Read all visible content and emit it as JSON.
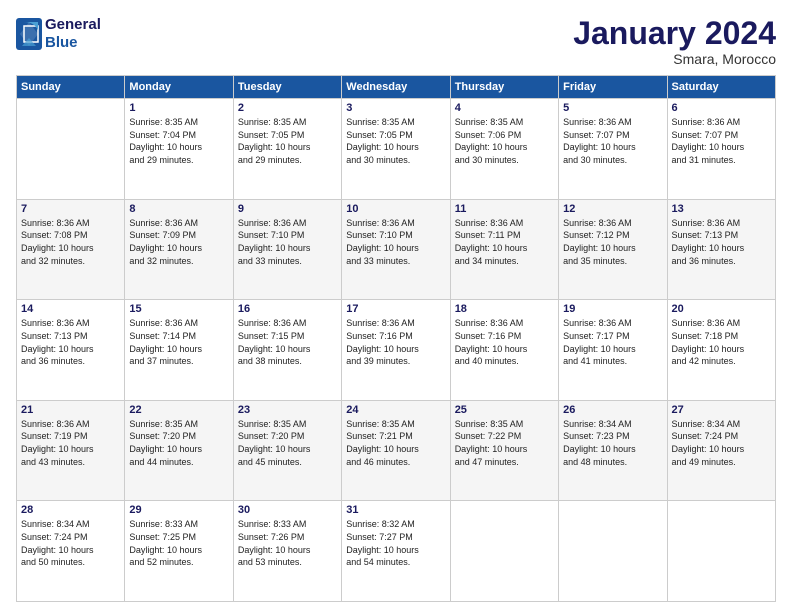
{
  "header": {
    "logo_line1": "General",
    "logo_line2": "Blue",
    "title": "January 2024",
    "subtitle": "Smara, Morocco"
  },
  "days_of_week": [
    "Sunday",
    "Monday",
    "Tuesday",
    "Wednesday",
    "Thursday",
    "Friday",
    "Saturday"
  ],
  "weeks": [
    [
      {
        "day": "",
        "info": ""
      },
      {
        "day": "1",
        "info": "Sunrise: 8:35 AM\nSunset: 7:04 PM\nDaylight: 10 hours\nand 29 minutes."
      },
      {
        "day": "2",
        "info": "Sunrise: 8:35 AM\nSunset: 7:05 PM\nDaylight: 10 hours\nand 29 minutes."
      },
      {
        "day": "3",
        "info": "Sunrise: 8:35 AM\nSunset: 7:05 PM\nDaylight: 10 hours\nand 30 minutes."
      },
      {
        "day": "4",
        "info": "Sunrise: 8:35 AM\nSunset: 7:06 PM\nDaylight: 10 hours\nand 30 minutes."
      },
      {
        "day": "5",
        "info": "Sunrise: 8:36 AM\nSunset: 7:07 PM\nDaylight: 10 hours\nand 30 minutes."
      },
      {
        "day": "6",
        "info": "Sunrise: 8:36 AM\nSunset: 7:07 PM\nDaylight: 10 hours\nand 31 minutes."
      }
    ],
    [
      {
        "day": "7",
        "info": "Sunrise: 8:36 AM\nSunset: 7:08 PM\nDaylight: 10 hours\nand 32 minutes."
      },
      {
        "day": "8",
        "info": "Sunrise: 8:36 AM\nSunset: 7:09 PM\nDaylight: 10 hours\nand 32 minutes."
      },
      {
        "day": "9",
        "info": "Sunrise: 8:36 AM\nSunset: 7:10 PM\nDaylight: 10 hours\nand 33 minutes."
      },
      {
        "day": "10",
        "info": "Sunrise: 8:36 AM\nSunset: 7:10 PM\nDaylight: 10 hours\nand 33 minutes."
      },
      {
        "day": "11",
        "info": "Sunrise: 8:36 AM\nSunset: 7:11 PM\nDaylight: 10 hours\nand 34 minutes."
      },
      {
        "day": "12",
        "info": "Sunrise: 8:36 AM\nSunset: 7:12 PM\nDaylight: 10 hours\nand 35 minutes."
      },
      {
        "day": "13",
        "info": "Sunrise: 8:36 AM\nSunset: 7:13 PM\nDaylight: 10 hours\nand 36 minutes."
      }
    ],
    [
      {
        "day": "14",
        "info": "Sunrise: 8:36 AM\nSunset: 7:13 PM\nDaylight: 10 hours\nand 36 minutes."
      },
      {
        "day": "15",
        "info": "Sunrise: 8:36 AM\nSunset: 7:14 PM\nDaylight: 10 hours\nand 37 minutes."
      },
      {
        "day": "16",
        "info": "Sunrise: 8:36 AM\nSunset: 7:15 PM\nDaylight: 10 hours\nand 38 minutes."
      },
      {
        "day": "17",
        "info": "Sunrise: 8:36 AM\nSunset: 7:16 PM\nDaylight: 10 hours\nand 39 minutes."
      },
      {
        "day": "18",
        "info": "Sunrise: 8:36 AM\nSunset: 7:16 PM\nDaylight: 10 hours\nand 40 minutes."
      },
      {
        "day": "19",
        "info": "Sunrise: 8:36 AM\nSunset: 7:17 PM\nDaylight: 10 hours\nand 41 minutes."
      },
      {
        "day": "20",
        "info": "Sunrise: 8:36 AM\nSunset: 7:18 PM\nDaylight: 10 hours\nand 42 minutes."
      }
    ],
    [
      {
        "day": "21",
        "info": "Sunrise: 8:36 AM\nSunset: 7:19 PM\nDaylight: 10 hours\nand 43 minutes."
      },
      {
        "day": "22",
        "info": "Sunrise: 8:35 AM\nSunset: 7:20 PM\nDaylight: 10 hours\nand 44 minutes."
      },
      {
        "day": "23",
        "info": "Sunrise: 8:35 AM\nSunset: 7:20 PM\nDaylight: 10 hours\nand 45 minutes."
      },
      {
        "day": "24",
        "info": "Sunrise: 8:35 AM\nSunset: 7:21 PM\nDaylight: 10 hours\nand 46 minutes."
      },
      {
        "day": "25",
        "info": "Sunrise: 8:35 AM\nSunset: 7:22 PM\nDaylight: 10 hours\nand 47 minutes."
      },
      {
        "day": "26",
        "info": "Sunrise: 8:34 AM\nSunset: 7:23 PM\nDaylight: 10 hours\nand 48 minutes."
      },
      {
        "day": "27",
        "info": "Sunrise: 8:34 AM\nSunset: 7:24 PM\nDaylight: 10 hours\nand 49 minutes."
      }
    ],
    [
      {
        "day": "28",
        "info": "Sunrise: 8:34 AM\nSunset: 7:24 PM\nDaylight: 10 hours\nand 50 minutes."
      },
      {
        "day": "29",
        "info": "Sunrise: 8:33 AM\nSunset: 7:25 PM\nDaylight: 10 hours\nand 52 minutes."
      },
      {
        "day": "30",
        "info": "Sunrise: 8:33 AM\nSunset: 7:26 PM\nDaylight: 10 hours\nand 53 minutes."
      },
      {
        "day": "31",
        "info": "Sunrise: 8:32 AM\nSunset: 7:27 PM\nDaylight: 10 hours\nand 54 minutes."
      },
      {
        "day": "",
        "info": ""
      },
      {
        "day": "",
        "info": ""
      },
      {
        "day": "",
        "info": ""
      }
    ]
  ]
}
